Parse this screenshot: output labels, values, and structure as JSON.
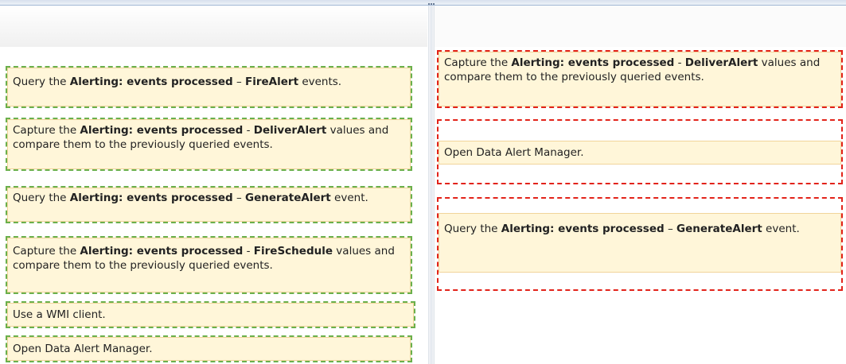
{
  "source_items": [
    {
      "parts": [
        {
          "t": "Query the "
        },
        {
          "t": "Alerting: events processed",
          "b": true
        },
        {
          "t": " – "
        },
        {
          "t": "FireAlert",
          "b": true
        },
        {
          "t": " events."
        }
      ]
    },
    {
      "parts": [
        {
          "t": "Capture the "
        },
        {
          "t": "Alerting: events processed",
          "b": true
        },
        {
          "t": " - "
        },
        {
          "t": "DeliverAlert",
          "b": true
        },
        {
          "t": " values and compare them to the previously queried events."
        }
      ]
    },
    {
      "parts": [
        {
          "t": "Query the "
        },
        {
          "t": "Alerting: events processed",
          "b": true
        },
        {
          "t": " – "
        },
        {
          "t": "GenerateAlert",
          "b": true
        },
        {
          "t": " event."
        }
      ]
    },
    {
      "parts": [
        {
          "t": "Capture the "
        },
        {
          "t": "Alerting: events processed",
          "b": true
        },
        {
          "t": " - "
        },
        {
          "t": "FireSchedule",
          "b": true
        },
        {
          "t": " values and compare them to the previously queried events."
        }
      ]
    },
    {
      "parts": [
        {
          "t": "Use a WMI client."
        }
      ]
    },
    {
      "parts": [
        {
          "t": "Open Data Alert Manager."
        }
      ]
    }
  ],
  "answer_items": [
    {
      "parts": [
        {
          "t": "Capture the "
        },
        {
          "t": "Alerting: events processed",
          "b": true
        },
        {
          "t": " - "
        },
        {
          "t": "DeliverAlert",
          "b": true
        },
        {
          "t": " values and compare them to the previously queried events."
        }
      ]
    },
    {
      "parts": [
        {
          "t": "Open Data Alert Manager."
        }
      ]
    },
    {
      "parts": [
        {
          "t": "Query the "
        },
        {
          "t": "Alerting: events processed",
          "b": true
        },
        {
          "t": " – "
        },
        {
          "t": "GenerateAlert",
          "b": true
        },
        {
          "t": " event."
        }
      ]
    }
  ],
  "colors": {
    "source_border": "#6ab04c",
    "answer_border": "#e2231a",
    "card_fill": "#fff6d9"
  }
}
